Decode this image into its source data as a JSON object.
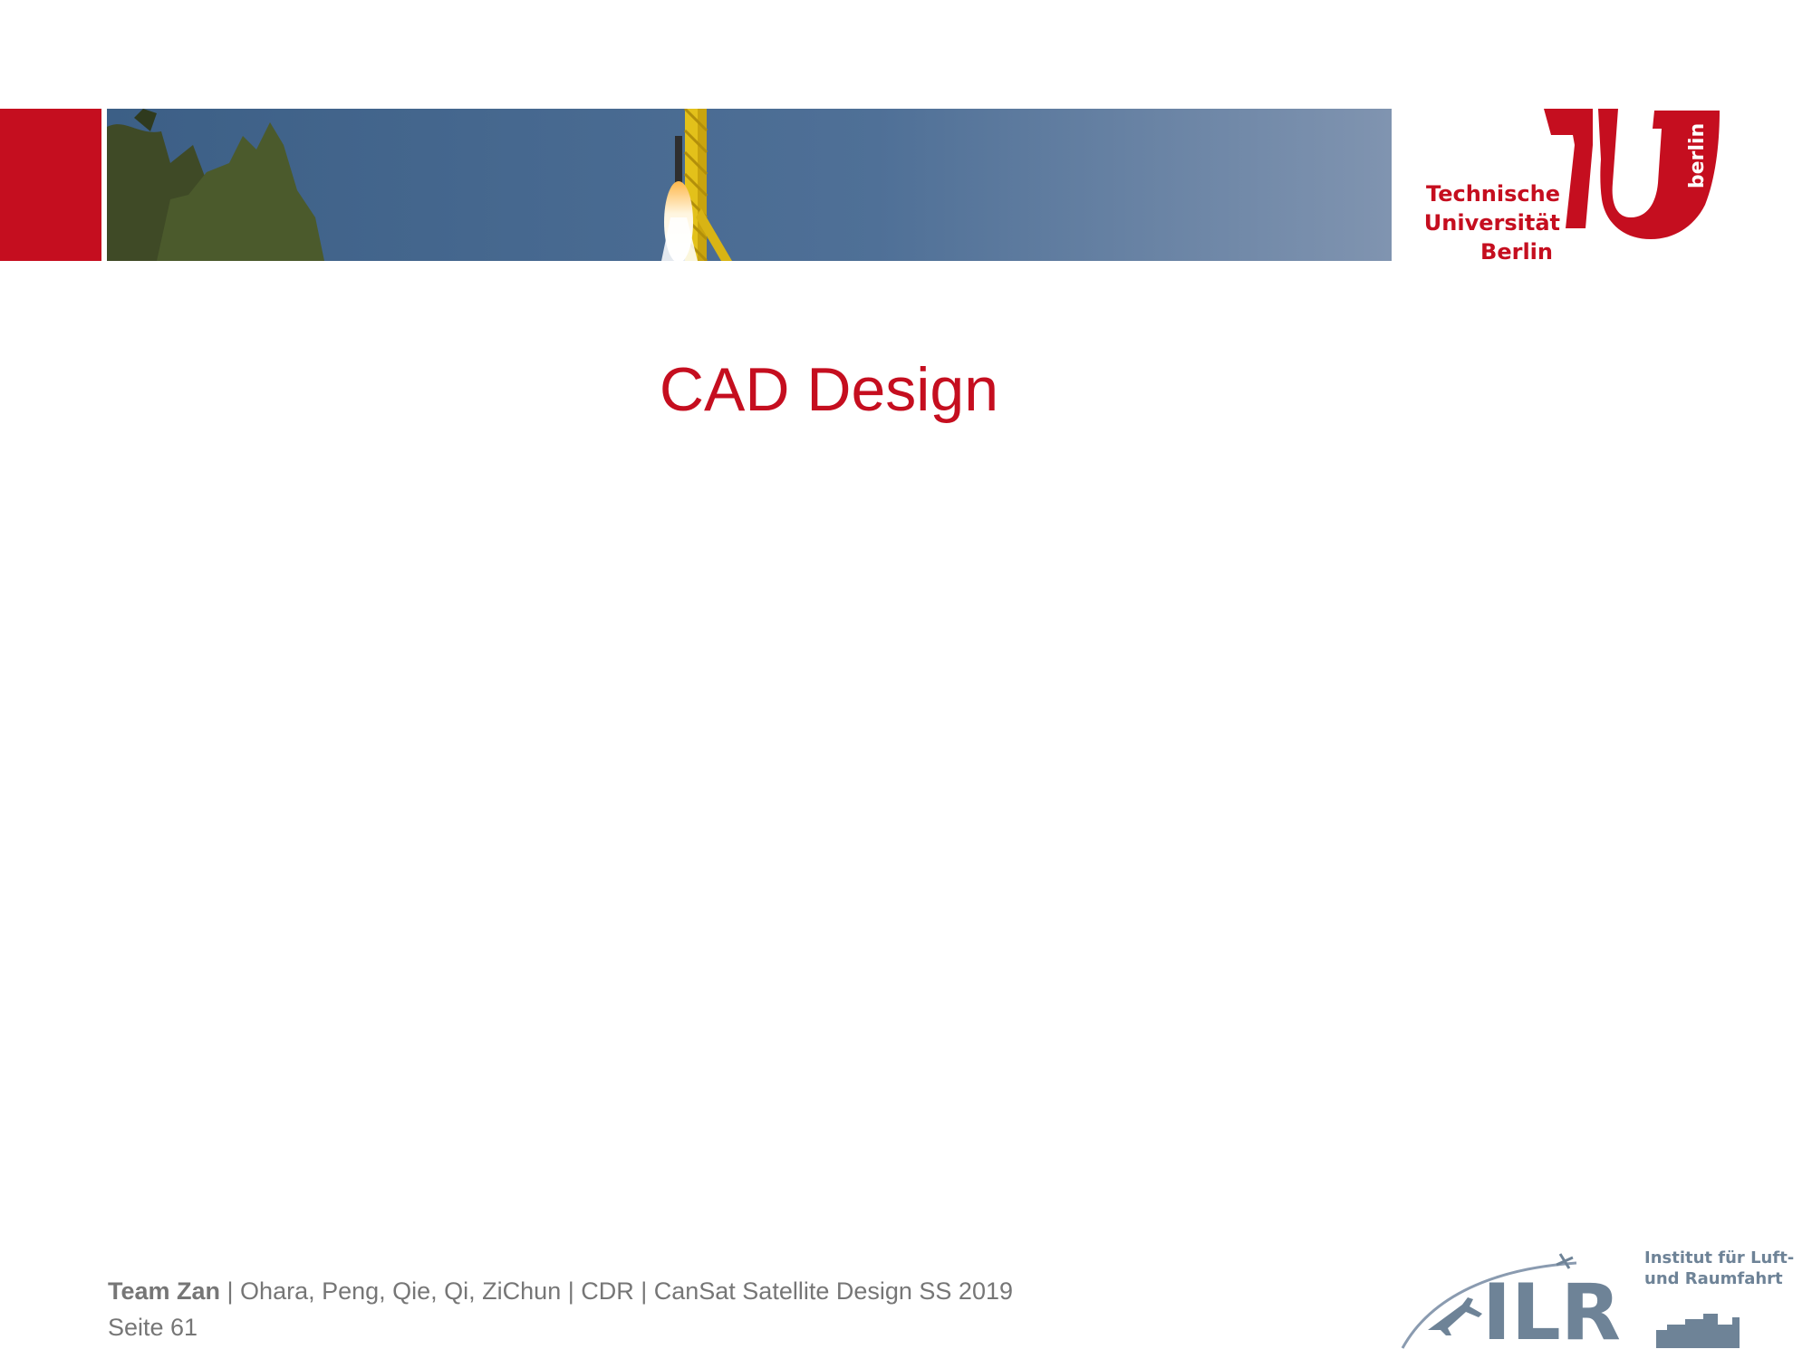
{
  "header": {
    "logo_lines": [
      "Technische",
      "Universität",
      "Berlin"
    ],
    "logo_vertical": "berlin",
    "brand_color": "#c50e1f"
  },
  "slide": {
    "title": "CAD Design"
  },
  "footer": {
    "team": "Team Zan",
    "details": " | Ohara, Peng, Qie, Qi, ZiChun | CDR | CanSat Satellite Design SS 2019",
    "page": "Seite 61"
  },
  "ilr_logo": {
    "letters": "ILR",
    "line1": "Institut für Luft-",
    "line2": "und Raumfahrt",
    "color": "#6e8397"
  }
}
